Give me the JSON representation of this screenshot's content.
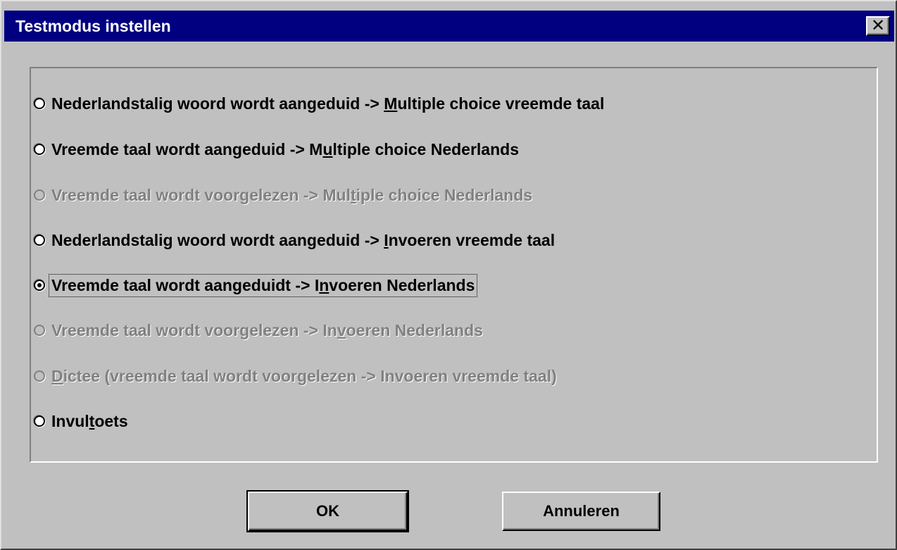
{
  "window": {
    "title": "Testmodus instellen",
    "close_glyph": "✕"
  },
  "options": [
    {
      "pre": "Nederlandstalig woord wordt aangeduid -> ",
      "key": "M",
      "post": "ultiple choice vreemde taal",
      "enabled": true,
      "checked": false
    },
    {
      "pre": "Vreemde taal wordt aangeduid -> M",
      "key": "u",
      "post": "ltiple choice Nederlands",
      "enabled": true,
      "checked": false
    },
    {
      "pre": "Vreemde taal wordt voorgelezen -> Mul",
      "key": "t",
      "post": "iple choice Nederlands",
      "enabled": false,
      "checked": false
    },
    {
      "pre": "Nederlandstalig woord wordt aangeduid -> ",
      "key": "I",
      "post": "nvoeren vreemde taal",
      "enabled": true,
      "checked": false
    },
    {
      "pre": "Vreemde taal wordt aangeduidt -> I",
      "key": "n",
      "post": "voeren Nederlands",
      "enabled": true,
      "checked": true
    },
    {
      "pre": "Vreemde taal wordt voorgelezen -> In",
      "key": "v",
      "post": "oeren Nederlands",
      "enabled": false,
      "checked": false
    },
    {
      "pre": "",
      "key": "D",
      "post": "ictee (vreemde taal wordt voorgelezen -> Invoeren vreemde taal)",
      "enabled": false,
      "checked": false
    },
    {
      "pre": "Invul",
      "key": "t",
      "post": "oets",
      "enabled": true,
      "checked": false
    }
  ],
  "buttons": {
    "ok_label": "OK",
    "cancel_label": "Annuleren"
  },
  "colors": {
    "title_bar": "#000080",
    "face": "#c0c0c0",
    "disabled_text": "#808080"
  }
}
